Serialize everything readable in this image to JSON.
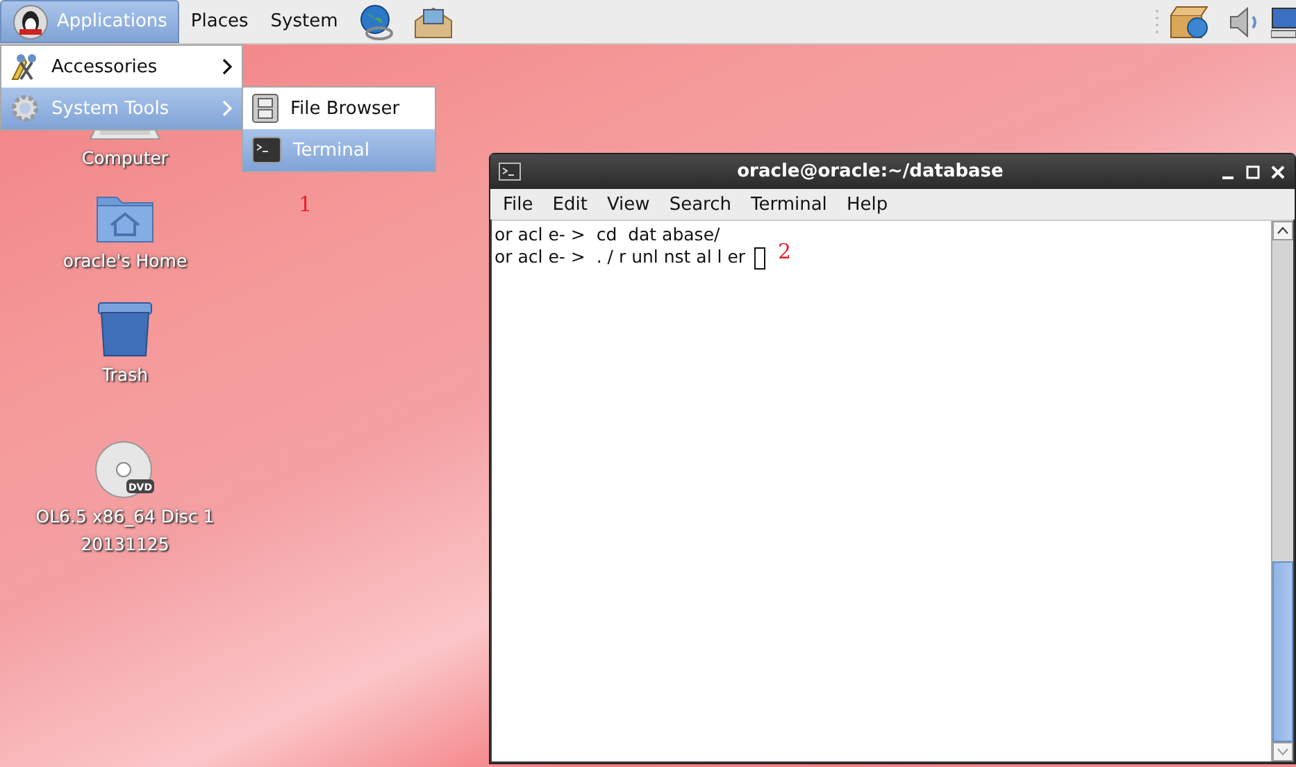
{
  "top_panel": {
    "menus": [
      {
        "label": "Applications",
        "selected": true
      },
      {
        "label": "Places",
        "selected": false
      },
      {
        "label": "System",
        "selected": false
      }
    ]
  },
  "applications_menu": {
    "items": [
      {
        "label": "Accessories",
        "kind": "accessories",
        "selected": false
      },
      {
        "label": "System Tools",
        "kind": "tools",
        "selected": true
      }
    ]
  },
  "system_tools_menu": {
    "items": [
      {
        "label": "File Browser",
        "kind": "files",
        "selected": false
      },
      {
        "label": "Terminal",
        "kind": "terminal",
        "selected": true
      }
    ]
  },
  "desktop_icons": [
    {
      "kind": "computer",
      "label_lines": [
        "Computer"
      ]
    },
    {
      "kind": "home",
      "label_lines": [
        "oracle's Home"
      ]
    },
    {
      "kind": "trash",
      "label_lines": [
        "Trash"
      ]
    },
    {
      "kind": "dvd",
      "badge": "DVD",
      "label_lines": [
        "OL6.5 x86_64 Disc 1",
        "20131125"
      ]
    }
  ],
  "annotations": [
    {
      "text": "1"
    },
    {
      "text": "2"
    }
  ],
  "terminal": {
    "title": "oracle@oracle:~/database",
    "menus": [
      "File",
      "Edit",
      "View",
      "Search",
      "Terminal",
      "Help"
    ],
    "lines": [
      "or acl e- >  cd  dat abase/",
      "or acl e- >  . / r unl nst al l er"
    ]
  }
}
